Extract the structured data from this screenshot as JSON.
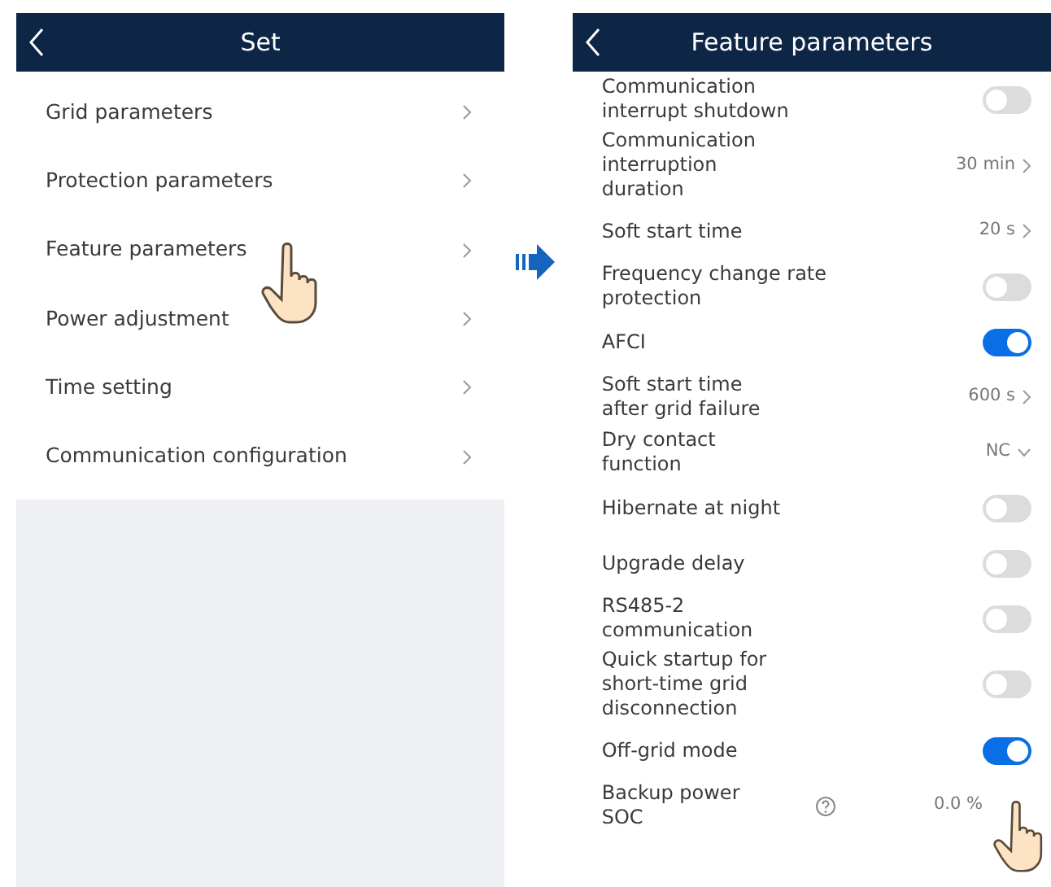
{
  "left_screen": {
    "title": "Set",
    "items": [
      {
        "label": "Grid parameters"
      },
      {
        "label": "Protection parameters"
      },
      {
        "label": "Feature parameters"
      },
      {
        "label": "Power adjustment"
      },
      {
        "label": "Time setting"
      },
      {
        "label": "Communication configuration"
      }
    ]
  },
  "right_screen": {
    "title": "Feature parameters",
    "items": [
      {
        "label": "Communication\ninterrupt shutdown",
        "kind": "toggle",
        "on": false
      },
      {
        "label": "Communication\ninterruption\nduration",
        "kind": "value",
        "value": "30 min"
      },
      {
        "label": "Soft start time",
        "kind": "value",
        "value": "20 s"
      },
      {
        "label": "Frequency change rate\nprotection",
        "kind": "toggle",
        "on": false
      },
      {
        "label": "AFCI",
        "kind": "toggle",
        "on": true
      },
      {
        "label": "Soft start time\nafter grid failure",
        "kind": "value",
        "value": "600 s"
      },
      {
        "label": "Dry contact\nfunction",
        "kind": "select",
        "value": "NC"
      },
      {
        "label": "Hibernate at night",
        "kind": "toggle",
        "on": false
      },
      {
        "label": "Upgrade delay",
        "kind": "toggle",
        "on": false
      },
      {
        "label": "RS485-2\ncommunication",
        "kind": "toggle",
        "on": false
      },
      {
        "label": "Quick startup for\nshort-time grid\ndisconnection",
        "kind": "toggle",
        "on": false
      },
      {
        "label": "Off-grid mode",
        "kind": "toggle",
        "on": true
      },
      {
        "label": "Backup power\nSOC",
        "kind": "help_value",
        "value": "0.0 %"
      }
    ]
  }
}
